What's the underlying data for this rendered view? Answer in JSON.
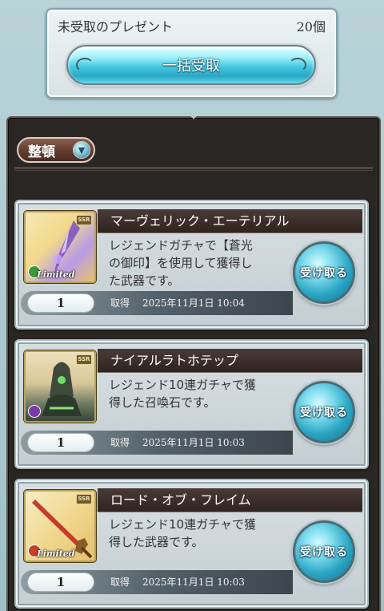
{
  "summary": {
    "label": "未受取のプレゼント",
    "count": "20個",
    "bulk_button": "一括受取"
  },
  "sort": {
    "label": "整頓",
    "icon": "chevron-down-icon"
  },
  "items": [
    {
      "name": "マーヴェリック・エーテリアル",
      "description_lines": [
        "レジェンドガチャで【蒼光",
        "の御印】を使用して獲得し",
        "た武器です。"
      ],
      "quantity": "1",
      "acquired_label": "取得",
      "acquired_date": "2025年11月1日 10:04",
      "button": "受け取る",
      "rarity": "SSR",
      "limited": "Limited",
      "element_color": "#3d9a3a"
    },
    {
      "name": "ナイアルラトホテップ",
      "description_lines": [
        "レジェンド10連ガチャで獲",
        "得した召喚石です。"
      ],
      "quantity": "1",
      "acquired_label": "取得",
      "acquired_date": "2025年11月1日 10:03",
      "button": "受け取る",
      "rarity": "SSR",
      "limited": "",
      "element_color": "#7a3aa8"
    },
    {
      "name": "ロード・オブ・フレイム",
      "description_lines": [
        "レジェンド10連ガチャで獲",
        "得した武器です。"
      ],
      "quantity": "1",
      "acquired_label": "取得",
      "acquired_date": "2025年11月1日 10:03",
      "button": "受け取る",
      "rarity": "SSR",
      "limited": "Limited",
      "element_color": "#c8402c"
    }
  ]
}
